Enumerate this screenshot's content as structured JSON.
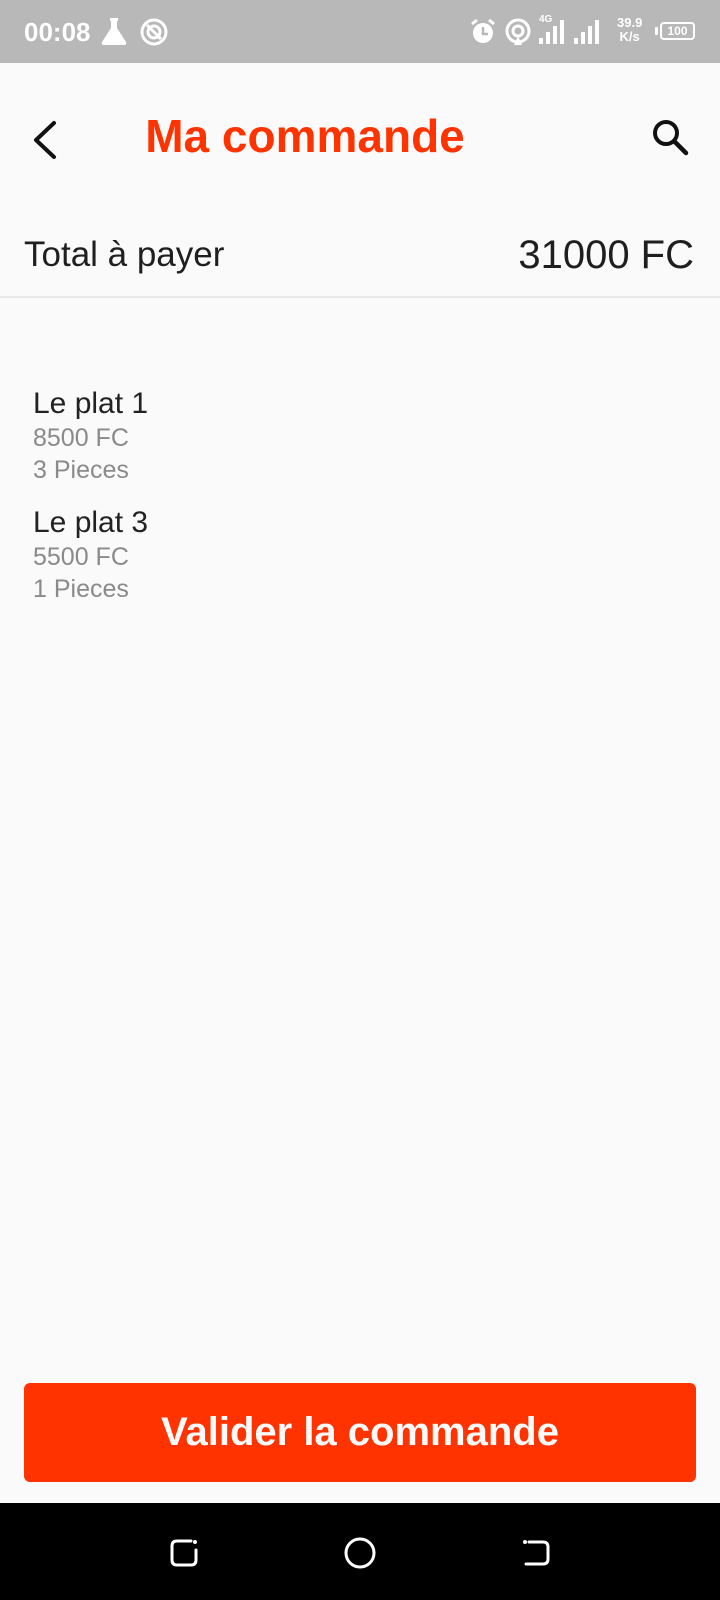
{
  "status_bar": {
    "time": "00:08",
    "network_speed_value": "39.9",
    "network_speed_unit": "K/s",
    "network_type": "4G",
    "battery": "100",
    "icons": [
      "flask-icon",
      "do-not-disturb-icon",
      "alarm-icon",
      "hotspot-icon",
      "signal-icon",
      "signal-icon",
      "battery-icon"
    ]
  },
  "header": {
    "title": "Ma commande",
    "back_icon": "back-arrow-icon",
    "search_icon": "search-icon"
  },
  "summary": {
    "total_label": "Total à payer",
    "total_value": "31000 FC"
  },
  "order_items": [
    {
      "name": "Le plat 1",
      "price": "8500 FC",
      "quantity": "3 Pieces"
    },
    {
      "name": "Le plat 3",
      "price": "5500 FC",
      "quantity": "1 Pieces"
    }
  ],
  "actions": {
    "validate_label": "Valider la commande"
  },
  "nav_bar": {
    "icons": [
      "recents-icon",
      "home-icon",
      "back-icon"
    ]
  },
  "colors": {
    "accent": "#ff3300",
    "status_bar": "#b8b8b8",
    "background": "#fafafa"
  }
}
